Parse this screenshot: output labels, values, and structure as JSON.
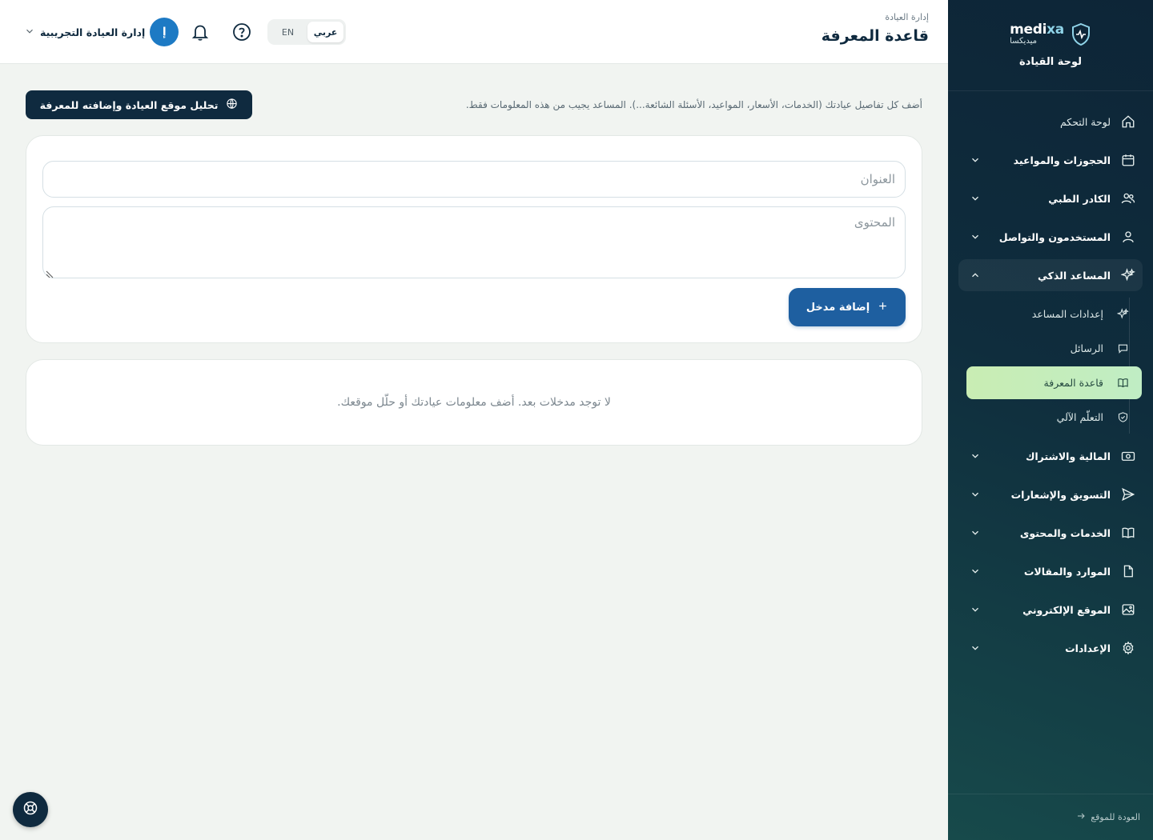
{
  "brand": {
    "name_main": "medi",
    "name_accent": "xa",
    "name_ar": "ميديكسا",
    "caption": "لوحة القيادة"
  },
  "nav": {
    "dashboard": "لوحة التحكم",
    "bookings": "الحجوزات والمواعيد",
    "staff": "الكادر الطبي",
    "users": "المستخدمون والتواصل",
    "assistant": "المساعد الذكي",
    "assistant_sub": {
      "settings": "إعدادات المساعد",
      "messages": "الرسائل",
      "knowledge": "قاعدة المعرفة",
      "learning": "التعلّم الآلي"
    },
    "finance": "المالية والاشتراك",
    "marketing": "التسويق والإشعارات",
    "services": "الخدمات والمحتوى",
    "resources": "الموارد والمقالات",
    "website": "الموقع الإلكتروني",
    "settings": "الإعدادات"
  },
  "footer": {
    "back": "العودة للموقع"
  },
  "header": {
    "breadcrumb": "إدارة العيادة",
    "title": "قاعدة المعرفة",
    "lang_ar": "عربي",
    "lang_en": "EN",
    "user_initial": "إ",
    "user_name": "إدارة العيادة التجريبية"
  },
  "main": {
    "intro": "أضف كل تفاصيل عيادتك (الخدمات، الأسعار، المواعيد، الأسئلة الشائعة...). المساعد يجيب من هذه المعلومات فقط.",
    "analyze_button": "تحليل موقع العيادة وإضافته للمعرفة",
    "title_placeholder": "العنوان",
    "content_placeholder": "المحتوى",
    "add_button": "إضافة مدخل",
    "empty": "لا توجد مدخلات بعد. أضف معلومات عيادتك أو حلّل موقعك."
  },
  "colors": {
    "sidebar": "#0f2d3d",
    "primary": "#1e5fa0",
    "dark": "#0f2a3f",
    "active_item": "#c9edb3"
  }
}
